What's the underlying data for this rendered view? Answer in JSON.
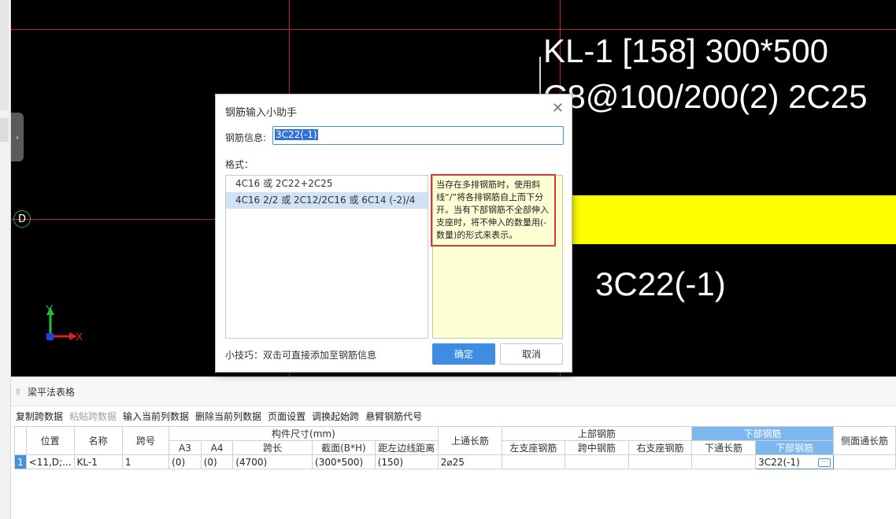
{
  "canvas": {
    "beam_label_line1": "KL-1 [158] 300*500",
    "beam_label_line2": "C8@100/200(2) 2C25",
    "bottom_rebar_label": "3C22(-1)",
    "axis_label": "D",
    "axis_y": "Y",
    "axis_x": "X",
    "colors": {
      "background": "#000000",
      "grid_line": "#c81e1e",
      "beam": "#ffff00"
    }
  },
  "dialog": {
    "title": "钢筋输入小助手",
    "info_label": "钢筋信息:",
    "info_value": "3C22(-1)",
    "format_label": "格式：",
    "format_options": [
      "4C16 或 2C22+2C25",
      "4C16 2/2 或 2C12/2C16 或 6C14 (-2)/4"
    ],
    "selected_option_index": 1,
    "hint_text": "当存在多排钢筋时，使用斜线“/”将各排钢筋自上而下分开。当有下部钢筋不全部伸入支座时，将不伸入的数量用(-数量)的形式来表示。",
    "tip": "小技巧：双击可直接添加至钢筋信息",
    "ok_label": "确定",
    "cancel_label": "取消"
  },
  "panel": {
    "title": "梁平法表格",
    "toolbar": [
      "复制跨数据",
      "粘贴跨数据",
      "输入当前列数据",
      "删除当前列数据",
      "页面设置",
      "调换起始跨",
      "悬臂钢筋代号"
    ],
    "toolbar_disabled_index": 1,
    "headers": {
      "position": "位置",
      "name": "名称",
      "span_no": "跨号",
      "dimension_group": "构件尺寸(mm)",
      "a3": "A3",
      "a4": "A4",
      "span_length": "跨长",
      "section": "截面(B*H)",
      "left_edge_distance": "距左边线距离",
      "top_through": "上通长筋",
      "top_group": "上部钢筋",
      "top_left": "左支座钢筋",
      "top_mid": "跨中钢筋",
      "top_right": "右支座钢筋",
      "bottom_group": "下部钢筋",
      "bottom_through": "下通长筋",
      "bottom_rebar": "下部钢筋",
      "side_through": "侧面通长筋"
    },
    "row": {
      "row_no": "1",
      "position": "<11,D;...",
      "name": "KL-1",
      "span_no": "1",
      "a3": "(0)",
      "a4": "(0)",
      "span_length": "(4700)",
      "section": "(300*500)",
      "left_edge_distance": "(150)",
      "top_through": "2⌀25",
      "top_left": "",
      "top_mid": "",
      "top_right": "",
      "bottom_through": "",
      "bottom_rebar": "3C22(-1)",
      "side_through": ""
    }
  }
}
